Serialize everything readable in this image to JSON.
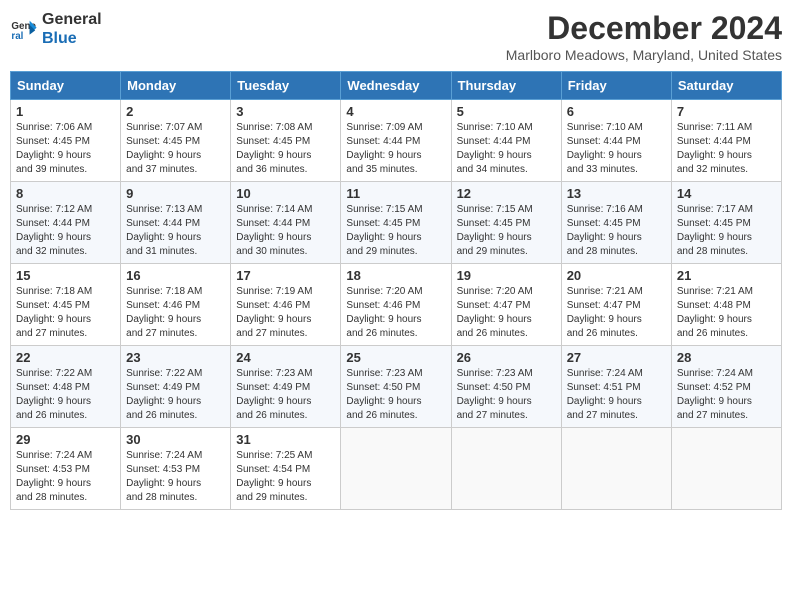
{
  "header": {
    "logo_line1": "General",
    "logo_line2": "Blue",
    "month_title": "December 2024",
    "location": "Marlboro Meadows, Maryland, United States"
  },
  "weekdays": [
    "Sunday",
    "Monday",
    "Tuesday",
    "Wednesday",
    "Thursday",
    "Friday",
    "Saturday"
  ],
  "weeks": [
    [
      {
        "day": "1",
        "sunrise": "7:06 AM",
        "sunset": "4:45 PM",
        "daylight": "9 hours and 39 minutes."
      },
      {
        "day": "2",
        "sunrise": "7:07 AM",
        "sunset": "4:45 PM",
        "daylight": "9 hours and 37 minutes."
      },
      {
        "day": "3",
        "sunrise": "7:08 AM",
        "sunset": "4:45 PM",
        "daylight": "9 hours and 36 minutes."
      },
      {
        "day": "4",
        "sunrise": "7:09 AM",
        "sunset": "4:44 PM",
        "daylight": "9 hours and 35 minutes."
      },
      {
        "day": "5",
        "sunrise": "7:10 AM",
        "sunset": "4:44 PM",
        "daylight": "9 hours and 34 minutes."
      },
      {
        "day": "6",
        "sunrise": "7:10 AM",
        "sunset": "4:44 PM",
        "daylight": "9 hours and 33 minutes."
      },
      {
        "day": "7",
        "sunrise": "7:11 AM",
        "sunset": "4:44 PM",
        "daylight": "9 hours and 32 minutes."
      }
    ],
    [
      {
        "day": "8",
        "sunrise": "7:12 AM",
        "sunset": "4:44 PM",
        "daylight": "9 hours and 32 minutes."
      },
      {
        "day": "9",
        "sunrise": "7:13 AM",
        "sunset": "4:44 PM",
        "daylight": "9 hours and 31 minutes."
      },
      {
        "day": "10",
        "sunrise": "7:14 AM",
        "sunset": "4:44 PM",
        "daylight": "9 hours and 30 minutes."
      },
      {
        "day": "11",
        "sunrise": "7:15 AM",
        "sunset": "4:45 PM",
        "daylight": "9 hours and 29 minutes."
      },
      {
        "day": "12",
        "sunrise": "7:15 AM",
        "sunset": "4:45 PM",
        "daylight": "9 hours and 29 minutes."
      },
      {
        "day": "13",
        "sunrise": "7:16 AM",
        "sunset": "4:45 PM",
        "daylight": "9 hours and 28 minutes."
      },
      {
        "day": "14",
        "sunrise": "7:17 AM",
        "sunset": "4:45 PM",
        "daylight": "9 hours and 28 minutes."
      }
    ],
    [
      {
        "day": "15",
        "sunrise": "7:18 AM",
        "sunset": "4:45 PM",
        "daylight": "9 hours and 27 minutes."
      },
      {
        "day": "16",
        "sunrise": "7:18 AM",
        "sunset": "4:46 PM",
        "daylight": "9 hours and 27 minutes."
      },
      {
        "day": "17",
        "sunrise": "7:19 AM",
        "sunset": "4:46 PM",
        "daylight": "9 hours and 27 minutes."
      },
      {
        "day": "18",
        "sunrise": "7:20 AM",
        "sunset": "4:46 PM",
        "daylight": "9 hours and 26 minutes."
      },
      {
        "day": "19",
        "sunrise": "7:20 AM",
        "sunset": "4:47 PM",
        "daylight": "9 hours and 26 minutes."
      },
      {
        "day": "20",
        "sunrise": "7:21 AM",
        "sunset": "4:47 PM",
        "daylight": "9 hours and 26 minutes."
      },
      {
        "day": "21",
        "sunrise": "7:21 AM",
        "sunset": "4:48 PM",
        "daylight": "9 hours and 26 minutes."
      }
    ],
    [
      {
        "day": "22",
        "sunrise": "7:22 AM",
        "sunset": "4:48 PM",
        "daylight": "9 hours and 26 minutes."
      },
      {
        "day": "23",
        "sunrise": "7:22 AM",
        "sunset": "4:49 PM",
        "daylight": "9 hours and 26 minutes."
      },
      {
        "day": "24",
        "sunrise": "7:23 AM",
        "sunset": "4:49 PM",
        "daylight": "9 hours and 26 minutes."
      },
      {
        "day": "25",
        "sunrise": "7:23 AM",
        "sunset": "4:50 PM",
        "daylight": "9 hours and 26 minutes."
      },
      {
        "day": "26",
        "sunrise": "7:23 AM",
        "sunset": "4:50 PM",
        "daylight": "9 hours and 27 minutes."
      },
      {
        "day": "27",
        "sunrise": "7:24 AM",
        "sunset": "4:51 PM",
        "daylight": "9 hours and 27 minutes."
      },
      {
        "day": "28",
        "sunrise": "7:24 AM",
        "sunset": "4:52 PM",
        "daylight": "9 hours and 27 minutes."
      }
    ],
    [
      {
        "day": "29",
        "sunrise": "7:24 AM",
        "sunset": "4:53 PM",
        "daylight": "9 hours and 28 minutes."
      },
      {
        "day": "30",
        "sunrise": "7:24 AM",
        "sunset": "4:53 PM",
        "daylight": "9 hours and 28 minutes."
      },
      {
        "day": "31",
        "sunrise": "7:25 AM",
        "sunset": "4:54 PM",
        "daylight": "9 hours and 29 minutes."
      },
      null,
      null,
      null,
      null
    ]
  ],
  "labels": {
    "sunrise": "Sunrise:",
    "sunset": "Sunset:",
    "daylight": "Daylight:"
  }
}
